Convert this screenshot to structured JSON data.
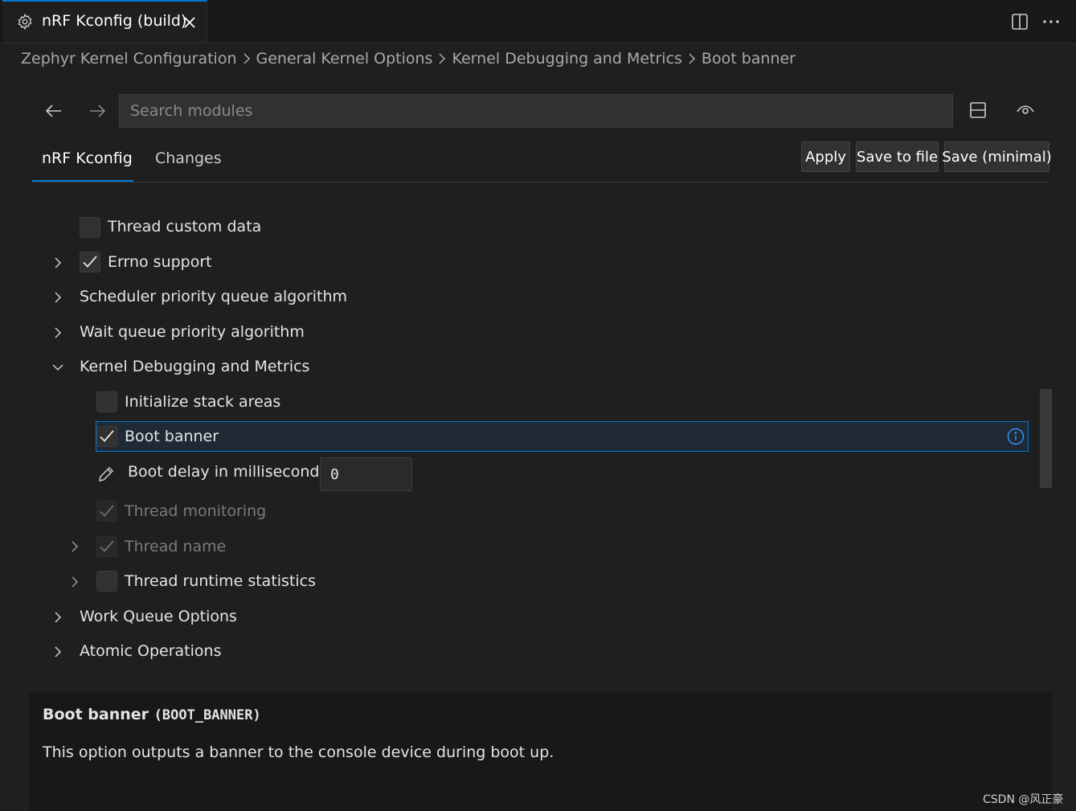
{
  "tab": {
    "title": "nRF Kconfig (build)",
    "icon": "gear-icon"
  },
  "breadcrumb": [
    "Zephyr Kernel Configuration",
    "General Kernel Options",
    "Kernel Debugging and Metrics",
    "Boot banner"
  ],
  "search": {
    "placeholder": "Search modules",
    "value": ""
  },
  "panel_tabs": [
    {
      "label": "nRF Kconfig",
      "active": true
    },
    {
      "label": "Changes",
      "active": false
    }
  ],
  "buttons": {
    "apply": "Apply",
    "save_to_file": "Save to file",
    "save_minimal": "Save (minimal)"
  },
  "tree": [
    {
      "label": "Thread custom data",
      "type": "checkbox",
      "checked": false,
      "expandable": false,
      "indent": 1
    },
    {
      "label": "Errno support",
      "type": "checkbox",
      "checked": true,
      "expandable": true,
      "indent": 1
    },
    {
      "label": "Scheduler priority queue algorithm",
      "type": "menu",
      "expandable": true,
      "indent": 1
    },
    {
      "label": "Wait queue priority algorithm",
      "type": "menu",
      "expandable": true,
      "indent": 1
    },
    {
      "label": "Kernel Debugging and Metrics",
      "type": "menu",
      "expanded": true,
      "indent": 1
    },
    {
      "label": "Initialize stack areas",
      "type": "checkbox",
      "checked": false,
      "indent": 2
    },
    {
      "label": "Boot banner",
      "type": "checkbox",
      "checked": true,
      "selected": true,
      "indent": 2
    },
    {
      "label": "Boot delay in milliseconds",
      "type": "int",
      "value": "0",
      "indent": 2
    },
    {
      "label": "Thread monitoring",
      "type": "checkbox",
      "checked": true,
      "disabled": true,
      "indent": 2
    },
    {
      "label": "Thread name",
      "type": "checkbox",
      "checked": true,
      "disabled": true,
      "expandable": true,
      "indent": 2
    },
    {
      "label": "Thread runtime statistics",
      "type": "checkbox",
      "checked": false,
      "expandable": true,
      "indent": 2
    },
    {
      "label": "Work Queue Options",
      "type": "menu",
      "expandable": true,
      "indent": 1
    },
    {
      "label": "Atomic Operations",
      "type": "menu",
      "expandable": true,
      "indent": 1
    }
  ],
  "info": {
    "title": "Boot banner",
    "symbol": "(BOOT_BANNER)",
    "description": "This option outputs a banner to the console device during boot up."
  },
  "watermark": "CSDN @风正豪",
  "colors": {
    "accent": "#0078d4",
    "background": "#1f1f1f",
    "panel": "#181818"
  }
}
